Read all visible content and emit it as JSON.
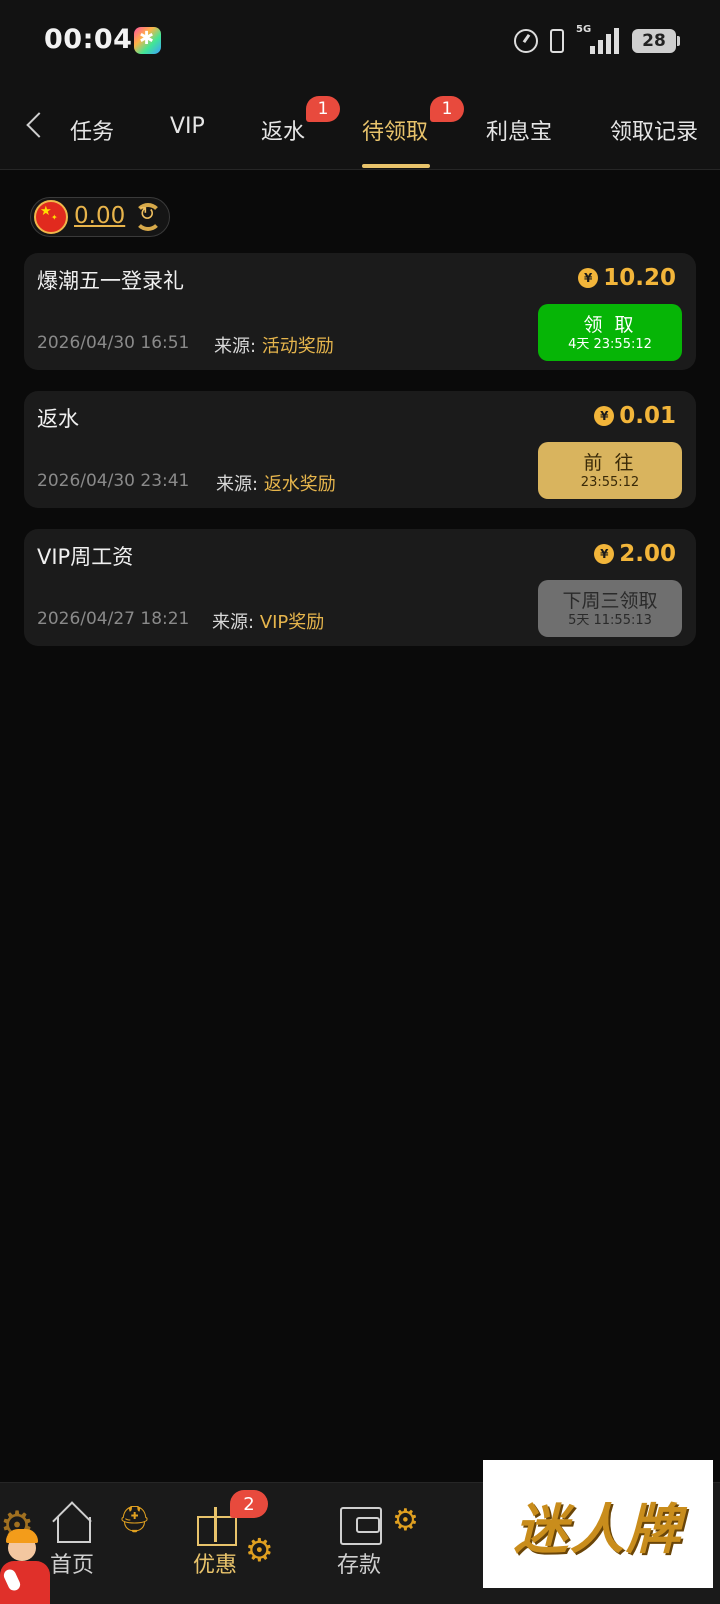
{
  "status_bar": {
    "time": "00:04",
    "network": "5G",
    "battery": "28"
  },
  "tabs": {
    "items": [
      {
        "label": "任务"
      },
      {
        "label": "VIP"
      },
      {
        "label": "返水",
        "badge": "1"
      },
      {
        "label": "待领取",
        "badge": "1",
        "active": true
      },
      {
        "label": "利息宝"
      },
      {
        "label": "领取记录"
      }
    ]
  },
  "balance": {
    "amount": "0.00"
  },
  "rewards": [
    {
      "title": "爆潮五一登录礼",
      "amount": "10.20",
      "date": "2026/04/30 16:51",
      "source_label": "来源:",
      "source_value": "活动奖励",
      "button_label": "领 取",
      "button_sub": "4天 23:55:12",
      "button_color": "#06b506"
    },
    {
      "title": "返水",
      "amount": "0.01",
      "date": "2026/04/30 23:41",
      "source_label": "来源:",
      "source_value": "返水奖励",
      "button_label": "前 往",
      "button_sub": "23:55:12",
      "button_color": "#d9b45e"
    },
    {
      "title": "VIP周工资",
      "amount": "2.00",
      "date": "2026/04/27 18:21",
      "source_label": "来源:",
      "source_value": "VIP奖励",
      "button_label": "下周三领取",
      "button_sub": "5天 11:55:13",
      "button_color": "#6f6f6f"
    }
  ],
  "coin_symbol": "¥",
  "bottom_nav": {
    "items": [
      {
        "label": "首页",
        "icon": "home-icon"
      },
      {
        "label": "优惠",
        "icon": "gift-icon",
        "active": true
      },
      {
        "label": "存款",
        "icon": "wallet-icon"
      }
    ],
    "promo_badge": "2"
  },
  "ad_overlay": {
    "logo_text": "迷人牌"
  },
  "colors": {
    "accent": "#e8c36b",
    "amount": "#f2b53a",
    "badge": "#e84a3d",
    "background": "#0a0a0a",
    "card": "#1b1b1b"
  }
}
